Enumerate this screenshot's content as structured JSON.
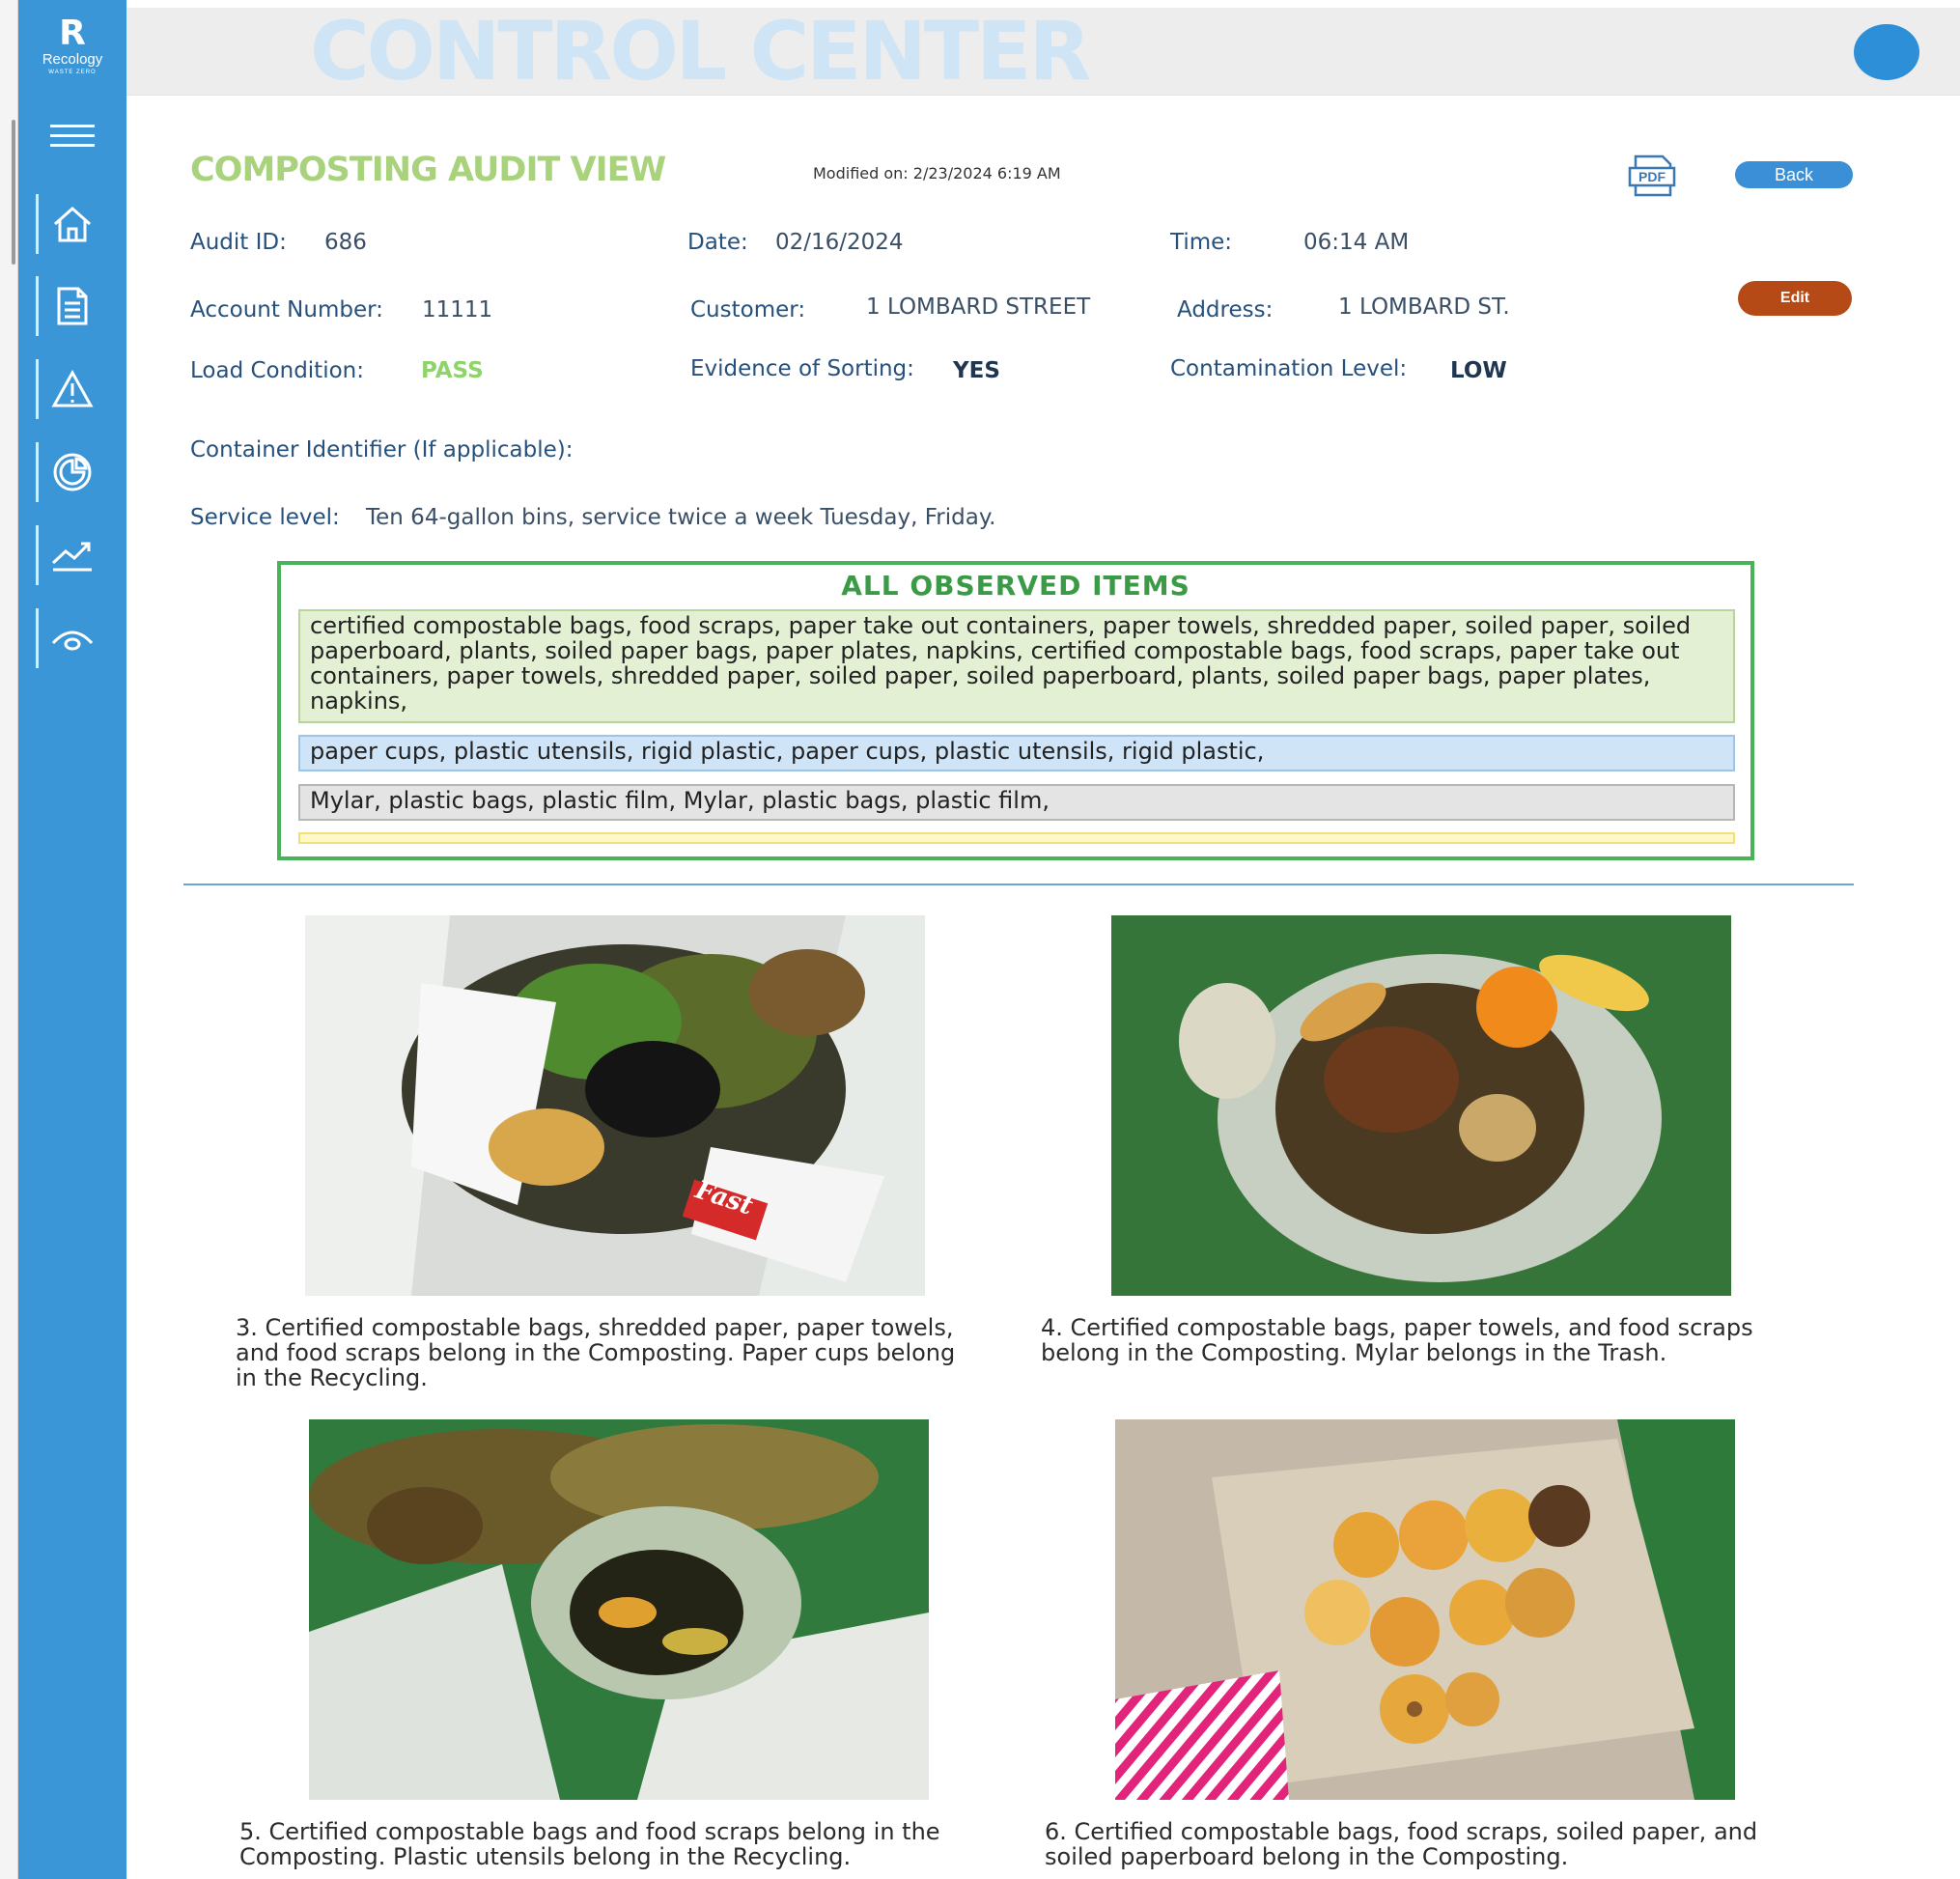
{
  "app": {
    "title": "CONTROL CENTER",
    "logo": {
      "letter": "R",
      "name": "Recology",
      "tagline": "WASTE ZERO"
    }
  },
  "sidebar": {
    "items": [
      {
        "icon": "menu-icon"
      },
      {
        "icon": "home-icon"
      },
      {
        "icon": "document-icon"
      },
      {
        "icon": "warning-icon"
      },
      {
        "icon": "pie-chart-icon"
      },
      {
        "icon": "trend-chart-icon"
      },
      {
        "icon": "eye-icon"
      }
    ]
  },
  "page": {
    "title": "COMPOSTING AUDIT VIEW",
    "modified": "Modified on: 2/23/2024 6:19 AM",
    "pdf_label": "PDF",
    "back_label": "Back",
    "edit_label": "Edit"
  },
  "audit": {
    "audit_id_label": "Audit ID:",
    "audit_id": "686",
    "date_label": "Date:",
    "date": "02/16/2024",
    "time_label": "Time:",
    "time": "06:14 AM",
    "account_label": "Account Number:",
    "account": "11111",
    "customer_label": "Customer:",
    "customer": "1 LOMBARD STREET",
    "address_label": "Address:",
    "address": "1 LOMBARD ST.",
    "load_label": "Load Condition:",
    "load": "PASS",
    "sorting_label": "Evidence of Sorting:",
    "sorting": "YES",
    "contamination_label": "Contamination Level:",
    "contamination": "LOW",
    "container_label": "Container Identifier (If applicable):",
    "service_label": "Service level:",
    "service": "Ten 64-gallon bins, service twice a week Tuesday, Friday."
  },
  "observed": {
    "title": "ALL OBSERVED ITEMS",
    "compost": "certified compostable bags, food scraps, paper take out containers, paper towels, shredded paper, soiled paper, soiled paperboard, plants, soiled paper bags, paper plates, napkins, certified compostable bags, food scraps, paper take out containers, paper towels, shredded paper, soiled paper, soiled paperboard, plants, soiled paper bags, paper plates, napkins,",
    "recycle": "paper cups, plastic utensils, rigid plastic, paper cups, plastic utensils, rigid plastic,",
    "trash": "Mylar, plastic bags, plastic film, Mylar, plastic bags, plastic film,",
    "other": ""
  },
  "photos": [
    {
      "caption_lines": [
        "3. Certified compostable bags, shredded paper, paper towels,",
        "and food scraps belong in the Composting. Paper cups belong",
        "in the Recycling."
      ],
      "cup_text": "Fast"
    },
    {
      "caption_lines": [
        "4. Certified compostable bags, paper towels, and food scraps",
        "belong in the Composting. Mylar belongs in the Trash."
      ]
    },
    {
      "caption_lines": [
        "5. Certified compostable bags and food scraps belong in the",
        "Composting. Plastic utensils belong in the Recycling."
      ]
    },
    {
      "caption_lines": [
        "6. Certified compostable bags, food scraps, soiled paper, and",
        "soiled paperboard belong in the Composting."
      ]
    }
  ],
  "colors": {
    "sidebar": "#3b96d8",
    "title_green": "#a8d37c",
    "pass_green": "#8fd36b",
    "back_blue": "#3a8fd6",
    "edit_brown": "#b54a17",
    "observed_border": "#4ab35a"
  }
}
